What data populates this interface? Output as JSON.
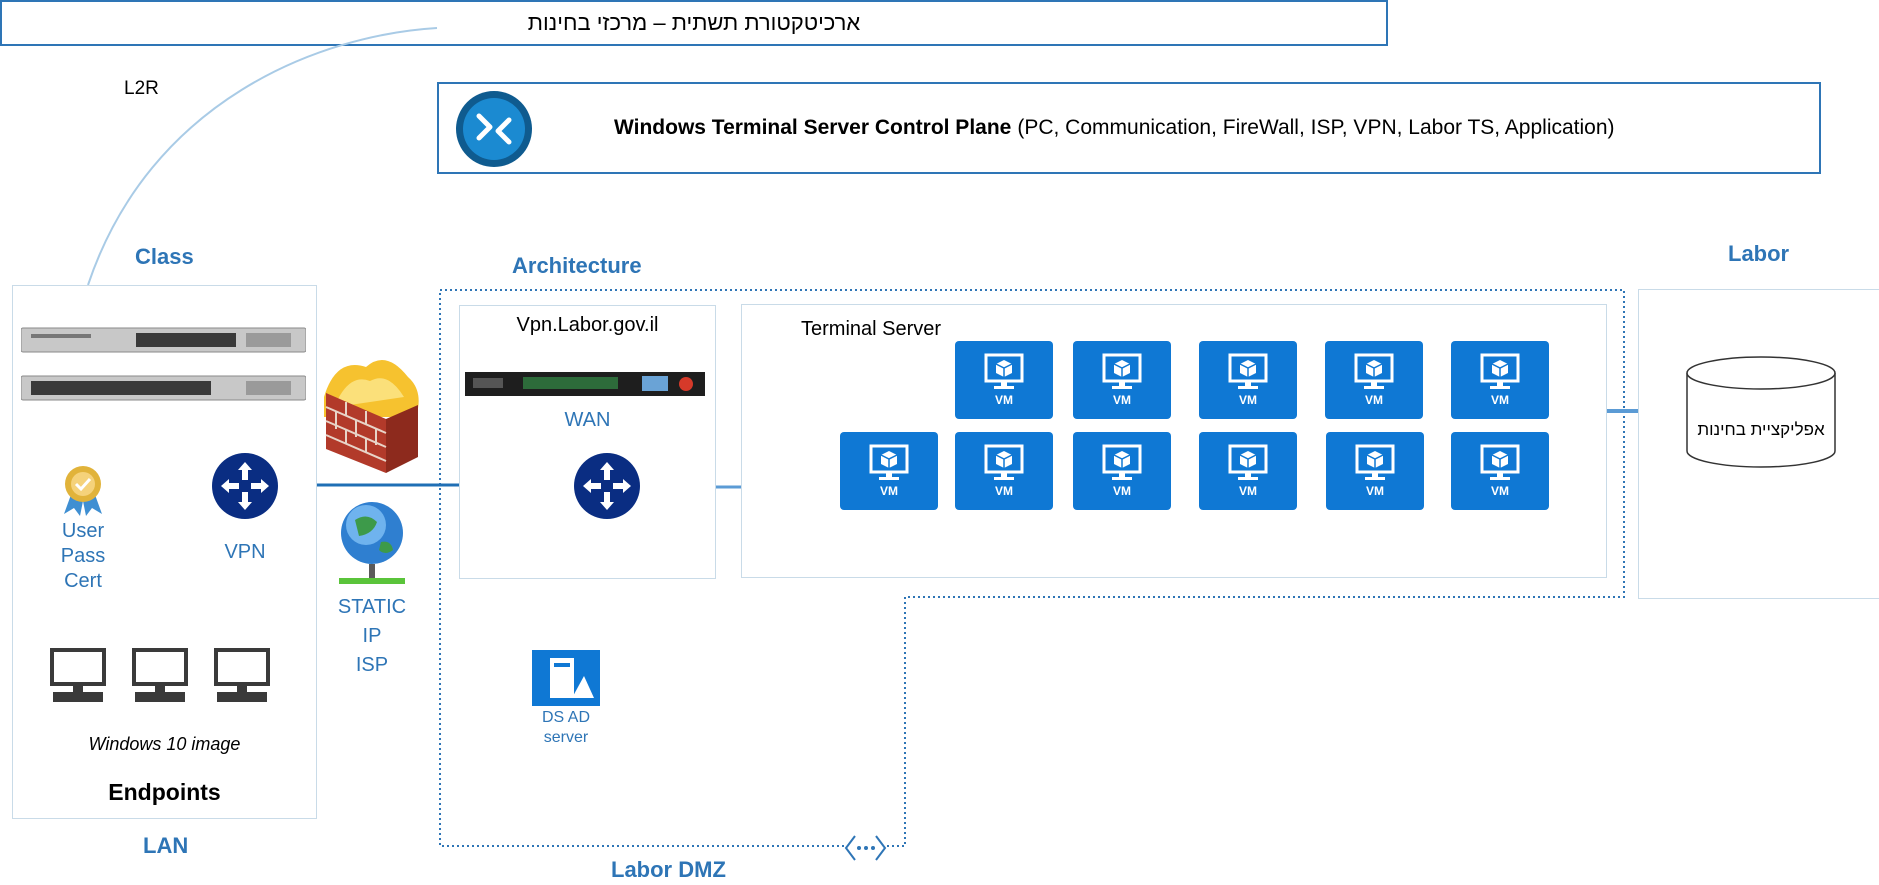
{
  "header": {
    "title": "ארכיטקטורת תשתית – מרכזי בחינות",
    "control_plane_bold": "Windows Terminal Server Control Plane",
    "control_plane_rest": "(PC, Communication, FireWall, ISP, VPN, Labor TS, Application)"
  },
  "labels": {
    "l2r": "L2R",
    "class": "Class",
    "architecture": "Architecture",
    "labor": "Labor",
    "lan": "LAN",
    "labor_dmz": "Labor DMZ"
  },
  "endpoints": {
    "user": "User",
    "pass": "Pass",
    "cert": "Cert",
    "vpn": "VPN",
    "windows_image": "Windows 10 image",
    "title": "Endpoints"
  },
  "isp": {
    "line1": "STATIC",
    "line2": "IP",
    "line3": "ISP"
  },
  "vpn_panel": {
    "host": "Vpn.Labor.gov.il",
    "wan": "WAN"
  },
  "dsad": {
    "line1": "DS AD",
    "line2": "server"
  },
  "terminal_server": {
    "title": "Terminal Server",
    "vm_label": "VM"
  },
  "labor_app": {
    "db_label": "אפליקציית בחינות"
  },
  "colors": {
    "accent": "#2e75b6",
    "vm_tile": "#0f78d4",
    "router": "#0a2d82",
    "panel_border": "#c9dbe8"
  }
}
